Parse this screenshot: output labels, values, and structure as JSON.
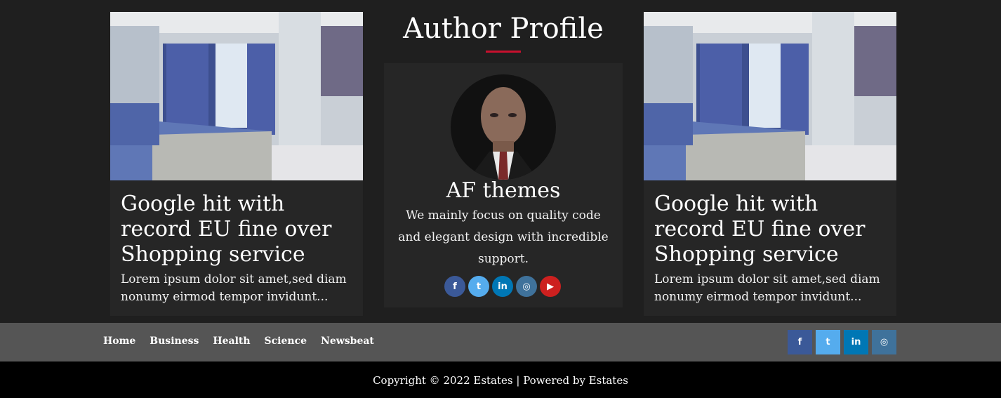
{
  "cards": [
    {
      "title": "Google hit with record EU fine over Shopping service",
      "excerpt": "Lorem ipsum dolor sit amet,sed diam nonumy eirmod tempor invidunt..."
    },
    {
      "title": "Google hit with record EU fine over Shopping service",
      "excerpt": "Lorem ipsum dolor sit amet,sed diam nonumy eirmod tempor invidunt..."
    }
  ],
  "author": {
    "section_title": "Author Profile",
    "name": "AF themes",
    "description": "We mainly focus on quality code and elegant design with incredible support.",
    "socials": [
      {
        "icon": "facebook-icon",
        "glyph": "f",
        "color": "#3b5998"
      },
      {
        "icon": "twitter-icon",
        "glyph": "t",
        "color": "#55acee"
      },
      {
        "icon": "linkedin-icon",
        "glyph": "in",
        "color": "#0077b5"
      },
      {
        "icon": "instagram-icon",
        "glyph": "◎",
        "color": "#3f729b"
      },
      {
        "icon": "youtube-icon",
        "glyph": "▶",
        "color": "#cd201f"
      }
    ]
  },
  "nav": {
    "items": [
      "Home",
      "Business",
      "Health",
      "Science",
      "Newsbeat"
    ],
    "socials": [
      {
        "icon": "facebook-icon",
        "glyph": "f",
        "color": "#3b5998"
      },
      {
        "icon": "twitter-icon",
        "glyph": "t",
        "color": "#55acee"
      },
      {
        "icon": "linkedin-icon",
        "glyph": "in",
        "color": "#0077b5"
      },
      {
        "icon": "instagram-icon",
        "glyph": "◎",
        "color": "#3f729b"
      }
    ]
  },
  "footer": {
    "copyright": "Copyright © 2022 Estates | Powered by Estates"
  },
  "colors": {
    "accent": "#c8102e",
    "background": "#1f1f1f",
    "card": "#262626",
    "navbar": "#555555"
  }
}
